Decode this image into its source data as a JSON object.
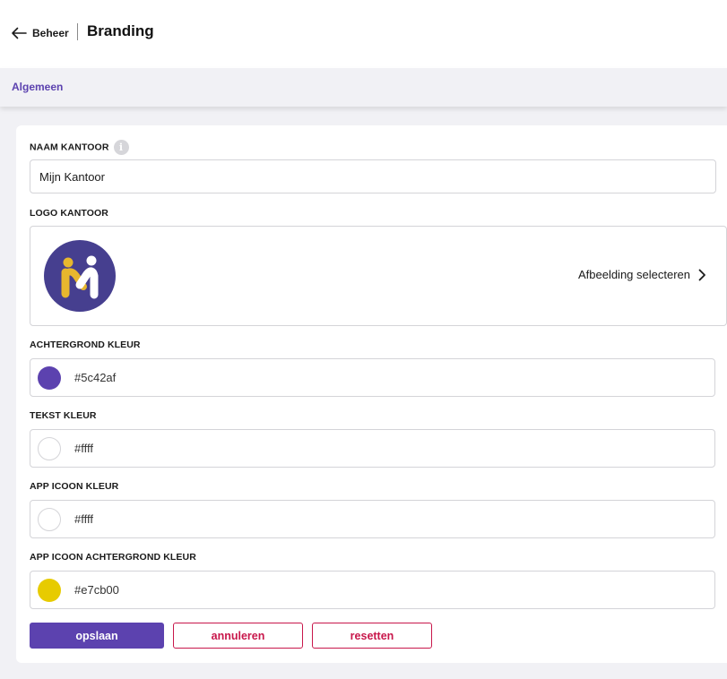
{
  "header": {
    "back_label": "Beheer",
    "title": "Branding"
  },
  "tabs": [
    {
      "label": "Algemeen",
      "active": true
    }
  ],
  "form": {
    "office_name": {
      "label": "NAAM KANTOOR",
      "value": "Mijn Kantoor"
    },
    "office_logo": {
      "label": "LOGO KANTOOR",
      "select_label": "Afbeelding selecteren"
    },
    "colors": [
      {
        "label": "ACHTERGROND KLEUR",
        "value": "#5c42af",
        "swatch": "#5c42af"
      },
      {
        "label": "TEKST KLEUR",
        "value": "#ffff",
        "swatch": "#ffffff"
      },
      {
        "label": "APP ICOON KLEUR",
        "value": "#ffff",
        "swatch": "#ffffff"
      },
      {
        "label": "APP ICOON ACHTERGROND KLEUR",
        "value": "#e7cb00",
        "swatch": "#e7cb00"
      }
    ]
  },
  "actions": {
    "save_label": "opslaan",
    "cancel_label": "annuleren",
    "reset_label": "resetten"
  },
  "theme": {
    "accent": "#5c42af",
    "danger": "#c8174b",
    "logo_background": "#463f8f",
    "logo_yellow": "#e7b72e"
  }
}
